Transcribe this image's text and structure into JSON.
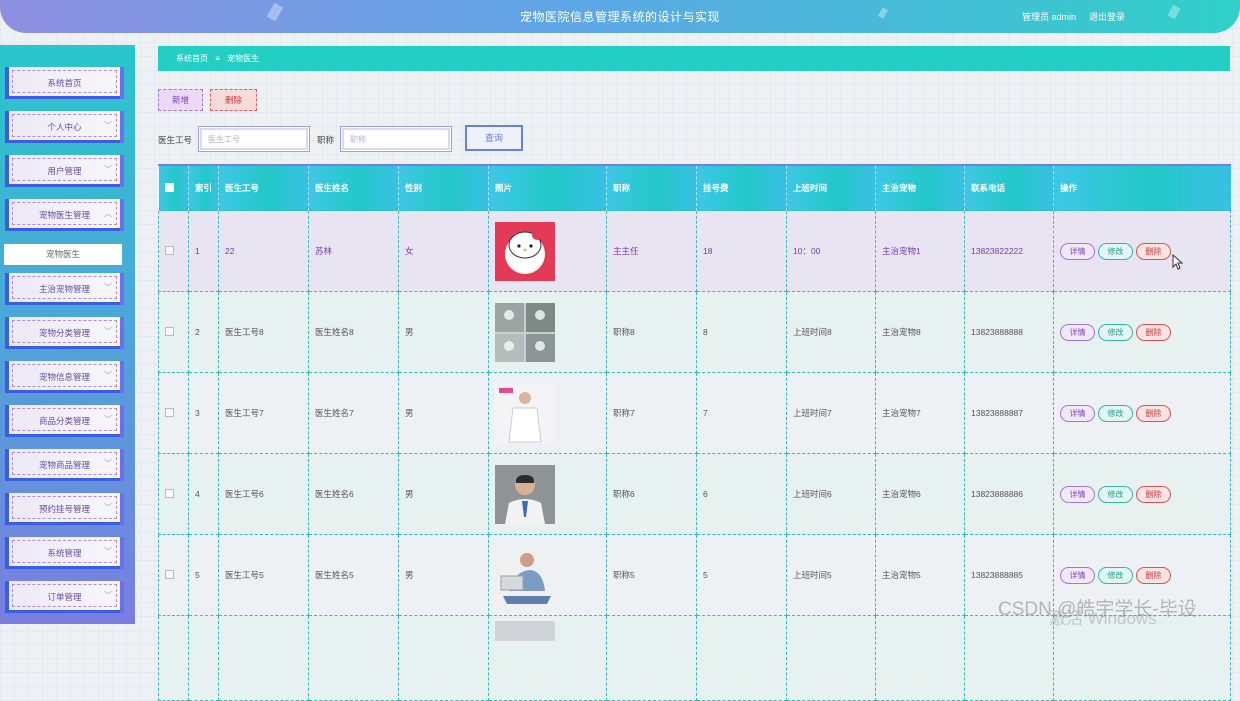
{
  "app": {
    "title": "宠物医院信息管理系统的设计与实现",
    "user": "管理员 admin",
    "logout": "退出登录"
  },
  "sidebar": {
    "items": [
      {
        "label": "系统首页",
        "chevron": false
      },
      {
        "label": "个人中心",
        "chevron": true
      },
      {
        "label": "用户管理",
        "chevron": true
      },
      {
        "label": "宠物医生管理",
        "chevron": true,
        "expanded": true
      },
      {
        "label": "主治宠物管理",
        "chevron": true
      },
      {
        "label": "宠物分类管理",
        "chevron": true
      },
      {
        "label": "宠物信息管理",
        "chevron": true
      },
      {
        "label": "商品分类管理",
        "chevron": true
      },
      {
        "label": "宠物商品管理",
        "chevron": true
      },
      {
        "label": "预约挂号管理",
        "chevron": true
      },
      {
        "label": "系统管理",
        "chevron": true
      },
      {
        "label": "订单管理",
        "chevron": true
      }
    ],
    "sub_active": "宠物医生"
  },
  "breadcrumb": {
    "home": "系统首页",
    "sep": "≡",
    "current": "宠物医生"
  },
  "toolbar": {
    "add": "新增",
    "delete": "删除"
  },
  "search": {
    "id_label": "医生工号",
    "id_placeholder": "医生工号",
    "title_label": "职称",
    "title_placeholder": "职称",
    "query": "查询"
  },
  "table": {
    "headers": [
      "索引",
      "医生工号",
      "医生姓名",
      "性别",
      "照片",
      "职称",
      "挂号费",
      "上班时间",
      "主治宠物",
      "联系电话",
      "操作"
    ],
    "rows": [
      {
        "index": "1",
        "id": "22",
        "name": "苏林",
        "gender": "女",
        "photo": "hello-kitty",
        "title": "主主任",
        "fee": "18",
        "time": "10：00",
        "pet": "主治宠物1",
        "phone": "13823822222"
      },
      {
        "index": "2",
        "id": "医生工号8",
        "name": "医生姓名8",
        "gender": "男",
        "photo": "doctors-group",
        "title": "职称8",
        "fee": "8",
        "time": "上班时间8",
        "pet": "主治宠物8",
        "phone": "13823888888"
      },
      {
        "index": "3",
        "id": "医生工号7",
        "name": "医生姓名7",
        "gender": "男",
        "photo": "doctor-white-coat",
        "title": "职称7",
        "fee": "7",
        "time": "上班时间7",
        "pet": "主治宠物7",
        "phone": "13823888887"
      },
      {
        "index": "4",
        "id": "医生工号6",
        "name": "医生姓名6",
        "gender": "男",
        "photo": "doctor-portrait",
        "title": "职称6",
        "fee": "6",
        "time": "上班时间6",
        "pet": "主治宠物6",
        "phone": "13823888886"
      },
      {
        "index": "5",
        "id": "医生工号5",
        "name": "医生姓名5",
        "gender": "男",
        "photo": "doctor-laptop",
        "title": "职称5",
        "fee": "5",
        "time": "上班时间5",
        "pet": "主治宠物5",
        "phone": "13823888885"
      }
    ],
    "ops": {
      "view": "详情",
      "edit": "修改",
      "del": "删除"
    }
  },
  "overlay": {
    "watermark": "CSDN @皓宇学长-毕设",
    "activate": "激活 Windows"
  },
  "colors": {
    "accent": "#22cfc2",
    "header_start": "#8f8fe0",
    "sidebar_end": "#7a7de0",
    "danger": "#c83838",
    "purple": "#7a40b8"
  }
}
